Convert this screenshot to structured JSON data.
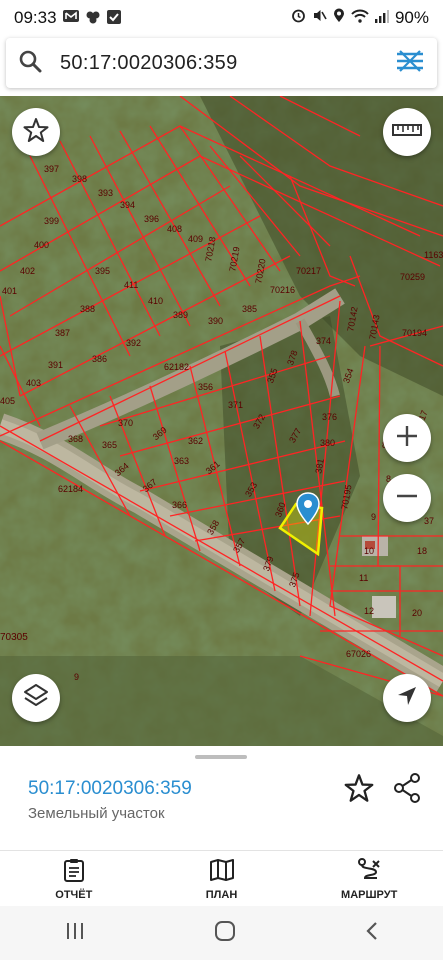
{
  "status_bar": {
    "time": "09:33",
    "battery": "90%",
    "left_icons": [
      "messages-icon",
      "weather-icon",
      "checkbox-icon"
    ],
    "right_icons": [
      "alarm-icon",
      "mute-icon",
      "location-icon",
      "wifi-icon",
      "signal-icon",
      "battery-icon"
    ]
  },
  "search": {
    "value": "50:17:0020306:359",
    "search_icon": "search-icon",
    "clear_icon": "clear-lines-icon"
  },
  "map": {
    "parcel_labels": [
      {
        "t": "397"
      },
      {
        "t": "398"
      },
      {
        "t": "399"
      },
      {
        "t": "400"
      },
      {
        "t": "401"
      },
      {
        "t": "402"
      },
      {
        "t": "393"
      },
      {
        "t": "394"
      },
      {
        "t": "395"
      },
      {
        "t": "396"
      },
      {
        "t": "408"
      },
      {
        "t": "409"
      },
      {
        "t": "411"
      },
      {
        "t": "410"
      },
      {
        "t": "389"
      },
      {
        "t": "388"
      },
      {
        "t": "387"
      },
      {
        "t": "386"
      },
      {
        "t": "392"
      },
      {
        "t": "391"
      },
      {
        "t": "390"
      },
      {
        "t": "385"
      },
      {
        "t": "403"
      },
      {
        "t": "70218"
      },
      {
        "t": "70219"
      },
      {
        "t": "70220"
      },
      {
        "t": "70217"
      },
      {
        "t": "70216"
      },
      {
        "t": "70259"
      },
      {
        "t": "1163"
      },
      {
        "t": "62182"
      },
      {
        "t": "356"
      },
      {
        "t": "355"
      },
      {
        "t": "378"
      },
      {
        "t": "374"
      },
      {
        "t": "354"
      },
      {
        "t": "371"
      },
      {
        "t": "372"
      },
      {
        "t": "376"
      },
      {
        "t": "370"
      },
      {
        "t": "369"
      },
      {
        "t": "368"
      },
      {
        "t": "365"
      },
      {
        "t": "362"
      },
      {
        "t": "364"
      },
      {
        "t": "363"
      },
      {
        "t": "361"
      },
      {
        "t": "367"
      },
      {
        "t": "366"
      },
      {
        "t": "377"
      },
      {
        "t": "380"
      },
      {
        "t": "381"
      },
      {
        "t": "353"
      },
      {
        "t": "360"
      },
      {
        "t": "358"
      },
      {
        "t": "357"
      },
      {
        "t": "379"
      },
      {
        "t": "375"
      },
      {
        "t": "62184"
      },
      {
        "t": "70195"
      },
      {
        "t": "70142"
      },
      {
        "t": "70143"
      },
      {
        "t": "9"
      },
      {
        "t": "10"
      },
      {
        "t": "11"
      },
      {
        "t": "12"
      },
      {
        "t": "18"
      },
      {
        "t": "20"
      },
      {
        "t": "67026"
      },
      {
        "t": "70305"
      },
      {
        "t": "9"
      },
      {
        "t": "417"
      },
      {
        "t": "37"
      },
      {
        "t": "8"
      },
      {
        "t": "8"
      },
      {
        "t": "70194"
      },
      {
        "t": "405"
      }
    ],
    "star_icon": "star-icon",
    "ruler_icon": "ruler-icon",
    "zoom_in_icon": "plus-icon",
    "zoom_out_icon": "minus-icon",
    "layers_icon": "layers-icon",
    "locate_icon": "navigation-arrow-icon",
    "pin_icon": "location-pin-icon",
    "parcel_line_color": "#ff2424",
    "selected_parcel_color": "#f0f000"
  },
  "details": {
    "cadastral_number": "50:17:0020306:359",
    "property_type": "Земельный участок",
    "favorite_icon": "star-outline-icon",
    "share_icon": "share-icon"
  },
  "bottom_nav": [
    {
      "label": "ОТЧЁТ",
      "icon": "report-clipboard-icon"
    },
    {
      "label": "ПЛАН",
      "icon": "map-book-icon"
    },
    {
      "label": "МАРШРУТ",
      "icon": "route-icon"
    }
  ],
  "system_nav": [
    "recents-icon",
    "home-icon",
    "back-icon"
  ]
}
